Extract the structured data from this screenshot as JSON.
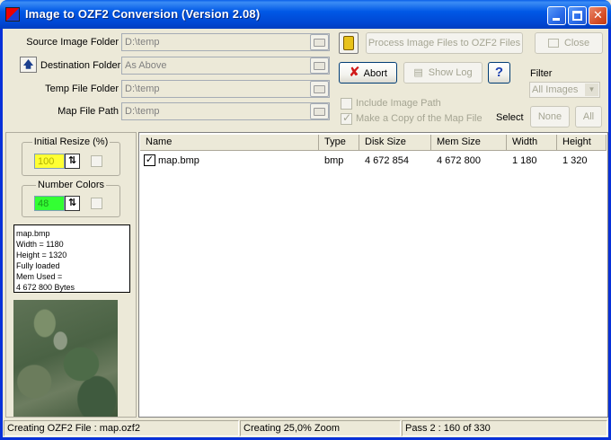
{
  "window": {
    "title": "Image to OZF2 Conversion (Version 2.08)"
  },
  "fields": {
    "source_label": "Source Image Folder",
    "source_value": "D:\\temp",
    "destination_label": "Destination Folder",
    "destination_value": "As Above",
    "temp_label": "Temp File Folder",
    "temp_value": "D:\\temp",
    "map_label": "Map File Path",
    "map_value": "D:\\temp"
  },
  "buttons": {
    "process": "Process Image Files to OZF2 Files",
    "close": "Close",
    "abort": "Abort",
    "show_log": "Show Log",
    "help": "?",
    "none": "None",
    "all": "All"
  },
  "options": {
    "include_image_path": "Include Image Path",
    "make_copy": "Make a Copy of the Map File",
    "filter_label": "Filter",
    "filter_value": "All Images",
    "select_label": "Select"
  },
  "left": {
    "resize_title": "Initial Resize (%)",
    "resize_value": "100",
    "colors_title": "Number Colors",
    "colors_value": "48",
    "info": [
      "map.bmp",
      "Width = 1180",
      "Height = 1320",
      "Fully loaded",
      "Mem Used =",
      "4 672 800 Bytes"
    ]
  },
  "table": {
    "columns": [
      "Name",
      "Type",
      "Disk Size",
      "Mem Size",
      "Width",
      "Height"
    ],
    "rows": [
      {
        "name": "map.bmp",
        "type": "bmp",
        "disk_size": "4 672 854",
        "mem_size": "4 672 800",
        "width": "1 180",
        "height": "1 320"
      }
    ]
  },
  "status": {
    "left": "Creating OZF2 File : map.ozf2",
    "middle": "Creating 25,0% Zoom",
    "right": "Pass 2 : 160 of 330"
  },
  "colors": {
    "titlebar": "#0058e6",
    "resize_value_bg": "#ffff33",
    "colors_value_bg": "#33ff33",
    "abort_icon": "#d01a1a"
  }
}
